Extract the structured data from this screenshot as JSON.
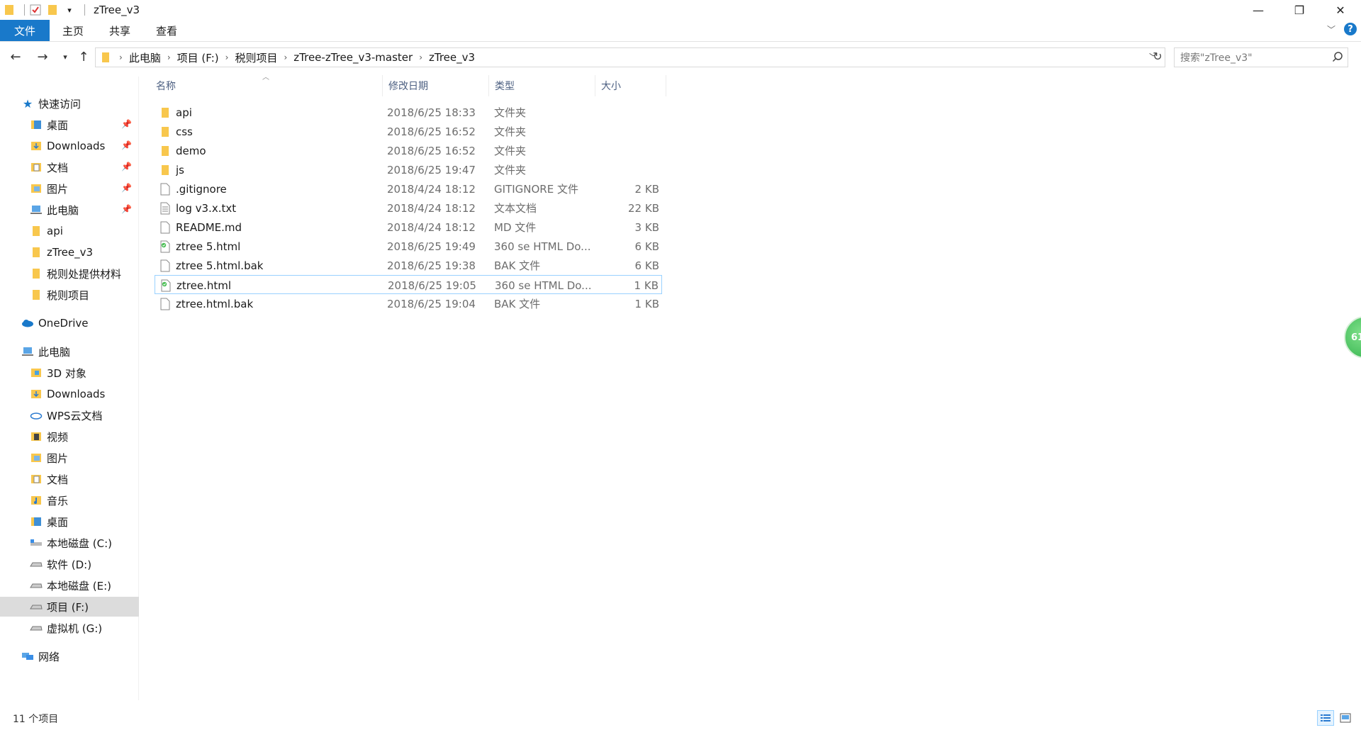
{
  "window": {
    "title": "zTree_v3",
    "controls": {
      "minimize": "—",
      "maximize": "❐",
      "close": "✕"
    }
  },
  "ribbon": {
    "tabs": [
      "文件",
      "主页",
      "共享",
      "查看"
    ],
    "help": "?"
  },
  "address": {
    "crumbs": [
      "此电脑",
      "项目 (F:)",
      "税则项目",
      "zTree-zTree_v3-master",
      "zTree_v3"
    ]
  },
  "search": {
    "placeholder": "搜索\"zTree_v3\""
  },
  "sidebar": {
    "quick_access": "快速访问",
    "pinned": [
      "桌面",
      "Downloads",
      "文档",
      "图片",
      "此电脑"
    ],
    "recent": [
      "api",
      "zTree_v3",
      "税则处提供材料",
      "税则项目"
    ],
    "onedrive": "OneDrive",
    "this_pc": "此电脑",
    "pc_items": [
      "3D 对象",
      "Downloads",
      "WPS云文档",
      "视频",
      "图片",
      "文档",
      "音乐",
      "桌面"
    ],
    "drives": [
      "本地磁盘 (C:)",
      "软件 (D:)",
      "本地磁盘 (E:)",
      "项目 (F:)",
      "虚拟机 (G:)"
    ],
    "network": "网络"
  },
  "columns": {
    "name": "名称",
    "date": "修改日期",
    "type": "类型",
    "size": "大小"
  },
  "files": [
    {
      "name": "api",
      "date": "2018/6/25 18:33",
      "type": "文件夹",
      "size": "",
      "icon": "folder"
    },
    {
      "name": "css",
      "date": "2018/6/25 16:52",
      "type": "文件夹",
      "size": "",
      "icon": "folder"
    },
    {
      "name": "demo",
      "date": "2018/6/25 16:52",
      "type": "文件夹",
      "size": "",
      "icon": "folder"
    },
    {
      "name": "js",
      "date": "2018/6/25 19:47",
      "type": "文件夹",
      "size": "",
      "icon": "folder"
    },
    {
      "name": ".gitignore",
      "date": "2018/4/24 18:12",
      "type": "GITIGNORE 文件",
      "size": "2 KB",
      "icon": "file"
    },
    {
      "name": "log v3.x.txt",
      "date": "2018/4/24 18:12",
      "type": "文本文档",
      "size": "22 KB",
      "icon": "text"
    },
    {
      "name": "README.md",
      "date": "2018/4/24 18:12",
      "type": "MD 文件",
      "size": "3 KB",
      "icon": "file"
    },
    {
      "name": "ztree 5.html",
      "date": "2018/6/25 19:49",
      "type": "360 se HTML Do...",
      "size": "6 KB",
      "icon": "html"
    },
    {
      "name": "ztree 5.html.bak",
      "date": "2018/6/25 19:38",
      "type": "BAK 文件",
      "size": "6 KB",
      "icon": "file"
    },
    {
      "name": "ztree.html",
      "date": "2018/6/25 19:05",
      "type": "360 se HTML Do...",
      "size": "1 KB",
      "icon": "html"
    },
    {
      "name": "ztree.html.bak",
      "date": "2018/6/25 19:04",
      "type": "BAK 文件",
      "size": "1 KB",
      "icon": "file"
    }
  ],
  "selected_index": 9,
  "status": {
    "count": "11 个项目"
  },
  "badge": {
    "text": "61"
  },
  "colors": {
    "accent": "#1979ca",
    "folder": "#f8c74d",
    "selection_border": "#99d1ff"
  }
}
